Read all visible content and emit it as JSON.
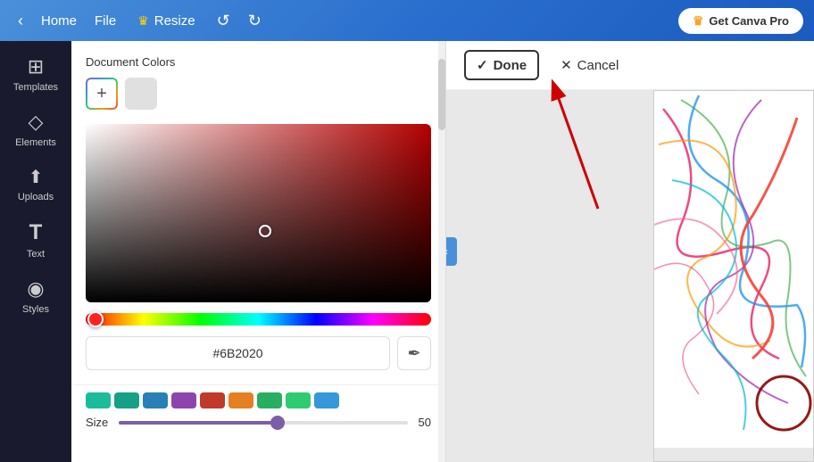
{
  "topbar": {
    "back_arrow": "‹",
    "home_label": "Home",
    "file_label": "File",
    "resize_label": "Resize",
    "undo_label": "↺",
    "redo_label": "↻",
    "get_pro_label": "Get Canva Pro",
    "crown_icon": "♛"
  },
  "sidebar": {
    "items": [
      {
        "id": "templates",
        "icon": "⊞",
        "label": "Templates"
      },
      {
        "id": "elements",
        "icon": "◇",
        "label": "Elements"
      },
      {
        "id": "uploads",
        "icon": "↑",
        "label": "Uploads"
      },
      {
        "id": "text",
        "icon": "T",
        "label": "Text"
      },
      {
        "id": "styles",
        "icon": "◉",
        "label": "Styles"
      }
    ]
  },
  "color_panel": {
    "doc_colors_label": "Document Colors",
    "add_button_label": "+",
    "hex_value": "#6B2020",
    "eyedropper_icon": "✒",
    "hue_position_percent": 2
  },
  "size_area": {
    "label": "Size",
    "value": "50",
    "swatches": [
      "#1abc9c",
      "#16a085",
      "#2980b9",
      "#8e44ad",
      "#c0392b",
      "#e67e22",
      "#27ae60",
      "#2ecc71"
    ]
  },
  "canvas": {
    "done_label": "Done",
    "cancel_label": "Cancel",
    "check_icon": "✓",
    "close_icon": "✕"
  }
}
